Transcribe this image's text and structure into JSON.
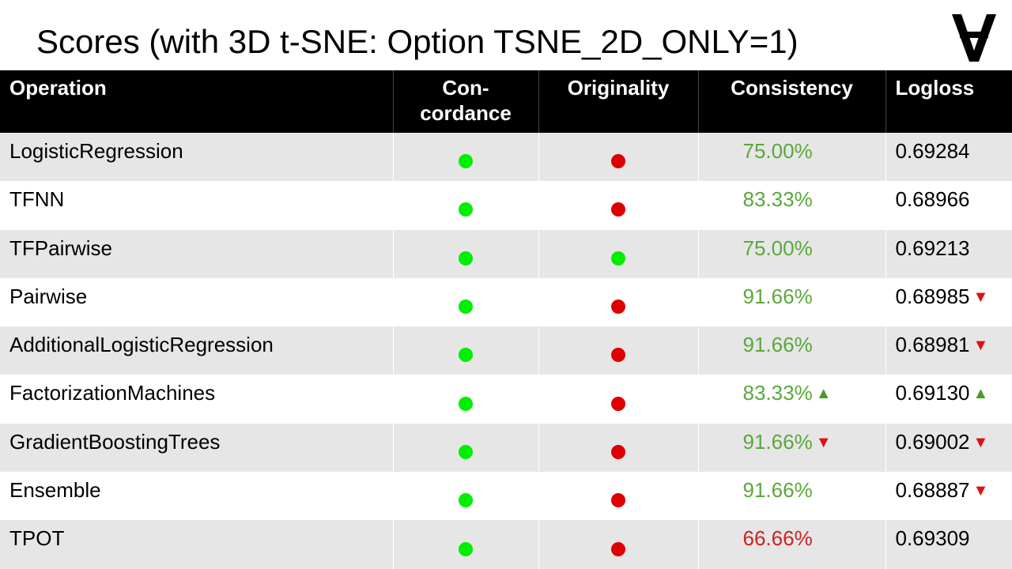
{
  "title": "Scores (with 3D t-SNE: Option TSNE_2D_ONLY=1)",
  "logo_icon": "inverted-a-logo-icon",
  "colors": {
    "good": "#00ee00",
    "bad": "#dd0000",
    "pct_good": "#5aa83a",
    "pct_bad": "#cc2222",
    "arrow_up": "#4a9a2a",
    "arrow_down": "#dd1111",
    "row_shade": "#e6e6e6",
    "header_bg": "#000000"
  },
  "columns": {
    "operation": "Operation",
    "concordance_line1": "Con-",
    "concordance_line2": "cordance",
    "originality": "Originality",
    "consistency": "Consistency",
    "logloss": "Logloss"
  },
  "rows": [
    {
      "operation": "LogisticRegression",
      "concordance": "good",
      "originality": "bad",
      "consistency": "75.00%",
      "consistency_status": "good",
      "consistency_arrow": "",
      "logloss": "0.69284",
      "logloss_arrow": ""
    },
    {
      "operation": "TFNN",
      "concordance": "good",
      "originality": "bad",
      "consistency": "83.33%",
      "consistency_status": "good",
      "consistency_arrow": "",
      "logloss": "0.68966",
      "logloss_arrow": ""
    },
    {
      "operation": "TFPairwise",
      "concordance": "good",
      "originality": "good",
      "consistency": "75.00%",
      "consistency_status": "good",
      "consistency_arrow": "",
      "logloss": "0.69213",
      "logloss_arrow": ""
    },
    {
      "operation": "Pairwise",
      "concordance": "good",
      "originality": "bad",
      "consistency": "91.66%",
      "consistency_status": "good",
      "consistency_arrow": "",
      "logloss": "0.68985",
      "logloss_arrow": "down"
    },
    {
      "operation": "AdditionalLogisticRegression",
      "concordance": "good",
      "originality": "bad",
      "consistency": "91.66%",
      "consistency_status": "good",
      "consistency_arrow": "",
      "logloss": "0.68981",
      "logloss_arrow": "down"
    },
    {
      "operation": "FactorizationMachines",
      "concordance": "good",
      "originality": "bad",
      "consistency": "83.33%",
      "consistency_status": "good",
      "consistency_arrow": "up",
      "logloss": "0.69130",
      "logloss_arrow": "up"
    },
    {
      "operation": "GradientBoostingTrees",
      "concordance": "good",
      "originality": "bad",
      "consistency": "91.66%",
      "consistency_status": "good",
      "consistency_arrow": "down",
      "logloss": "0.69002",
      "logloss_arrow": "down"
    },
    {
      "operation": "Ensemble",
      "concordance": "good",
      "originality": "bad",
      "consistency": "91.66%",
      "consistency_status": "good",
      "consistency_arrow": "",
      "logloss": "0.68887",
      "logloss_arrow": "down"
    },
    {
      "operation": "TPOT",
      "concordance": "good",
      "originality": "bad",
      "consistency": "66.66%",
      "consistency_status": "bad",
      "consistency_arrow": "",
      "logloss": "0.69309",
      "logloss_arrow": ""
    }
  ]
}
